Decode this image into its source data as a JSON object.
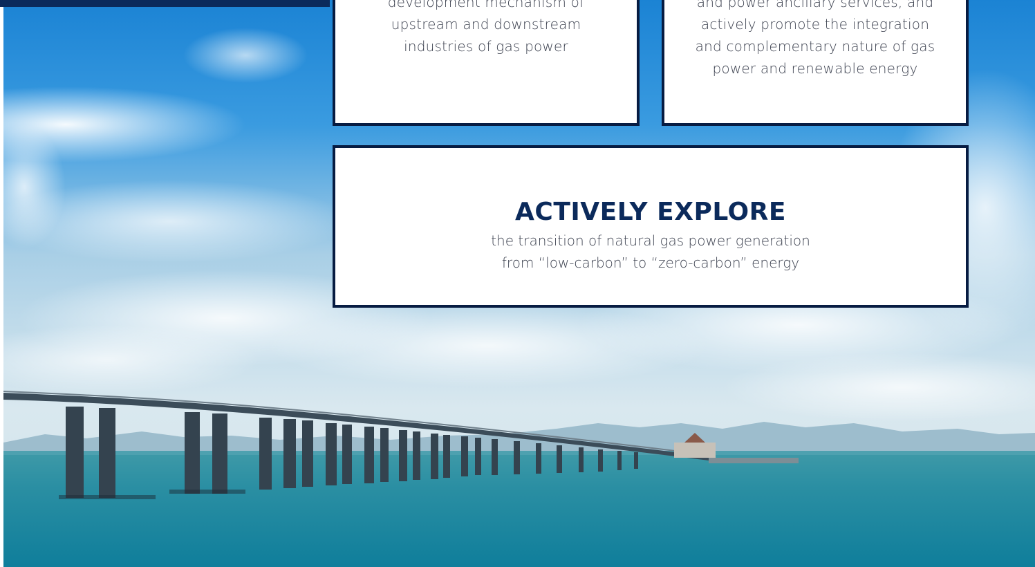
{
  "cards": {
    "top_left": {
      "lines": [
        "development mechanism of",
        "upstream and downstream",
        "industries of gas power"
      ]
    },
    "top_right": {
      "lines": [
        "and power ancillary services, and",
        "actively promote the integration",
        "and complementary nature of gas",
        "power and renewable energy"
      ]
    },
    "bottom": {
      "heading": "ACTIVELY EXPLORE",
      "lines": [
        "the transition of natural gas power generation",
        "from “low-carbon” to “zero-carbon” energy"
      ]
    }
  },
  "colors": {
    "card_border": "#071c42",
    "heading": "#0b2a5b",
    "body_text": "#3d4250",
    "top_bar": "#0b2a5b"
  },
  "background": {
    "image_subject": "sea-bridge-photo"
  }
}
